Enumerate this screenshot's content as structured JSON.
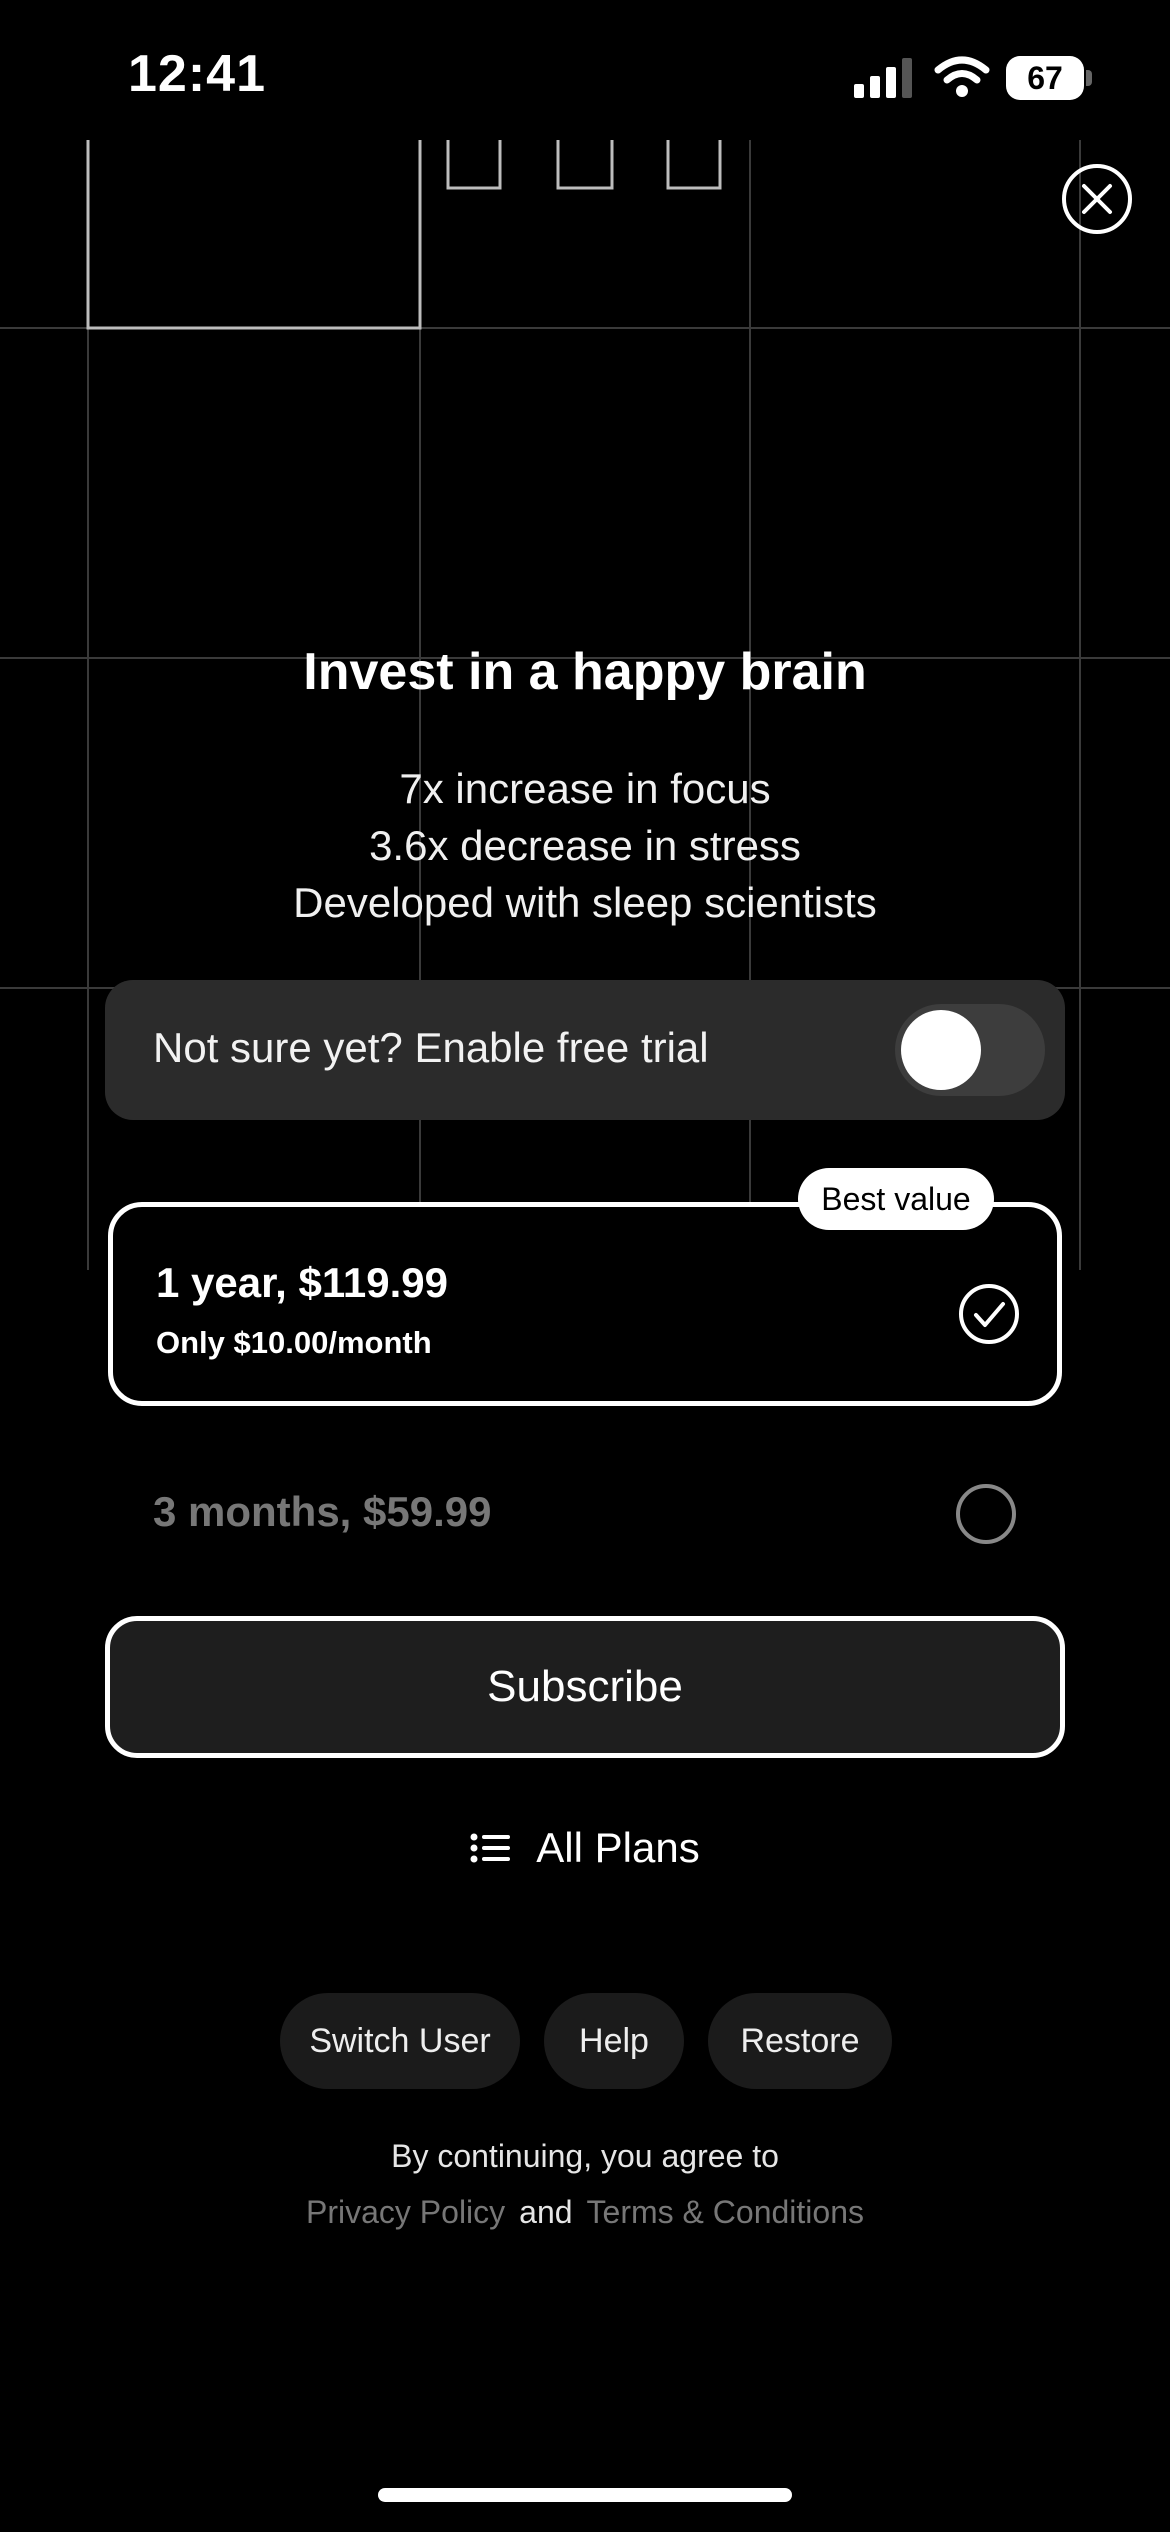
{
  "status_bar": {
    "time": "12:41",
    "battery": "67",
    "icons": [
      "signal-icon",
      "wifi-icon",
      "battery-icon"
    ]
  },
  "close_icon": "close-icon",
  "headline": "Invest in a happy brain",
  "benefits": [
    "7x increase in focus",
    "3.6x decrease in stress",
    "Developed with sleep scientists"
  ],
  "trial": {
    "label": "Not sure yet? Enable free trial",
    "enabled": false
  },
  "plans": [
    {
      "title": "1 year, $119.99",
      "subtitle": "Only $10.00/month",
      "badge": "Best value",
      "selected": true
    },
    {
      "title": "3 months, $59.99",
      "selected": false
    }
  ],
  "subscribe_label": "Subscribe",
  "all_plans": {
    "label": "All Plans",
    "icon": "list-icon"
  },
  "footer_buttons": {
    "switch_user": "Switch User",
    "help": "Help",
    "restore": "Restore"
  },
  "legal": {
    "line1": "By continuing, you agree to",
    "privacy": "Privacy Policy",
    "and": "and",
    "terms": "Terms & Conditions"
  },
  "colors": {
    "background": "#000000",
    "card": "#2b2b2b",
    "muted_text": "#777777",
    "accent": "#ffffff"
  }
}
